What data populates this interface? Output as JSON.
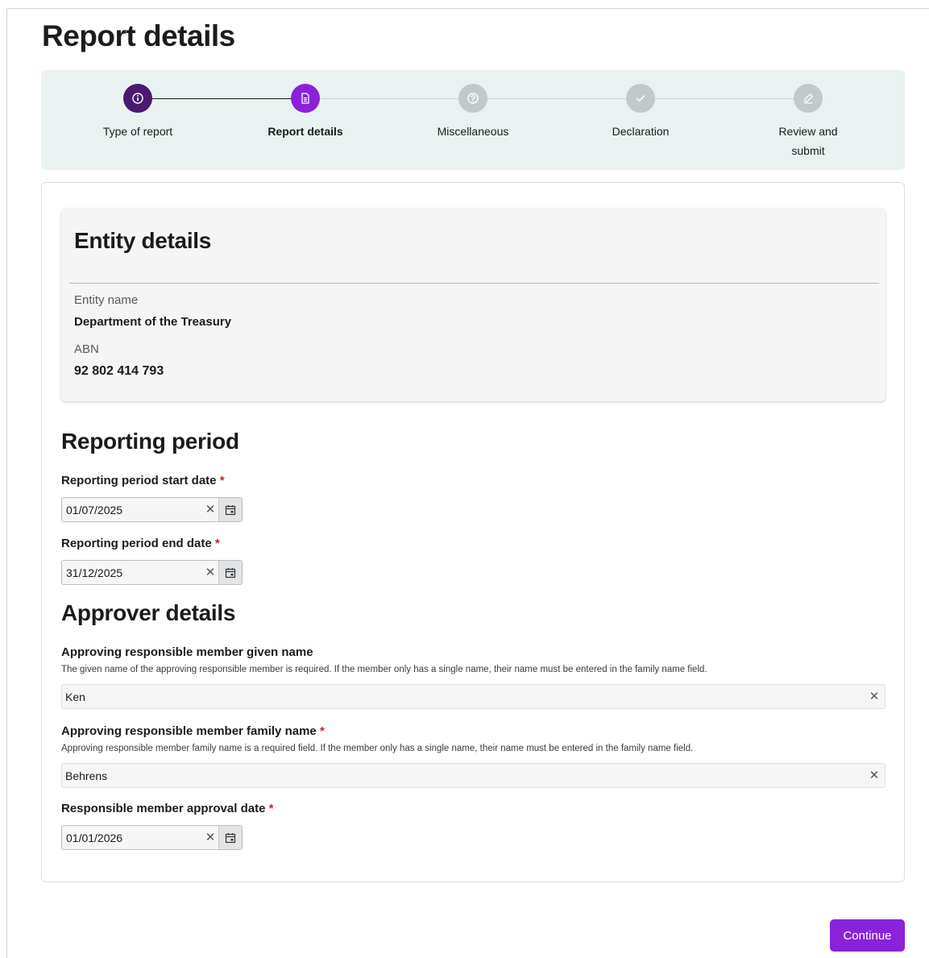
{
  "page": {
    "title": "Report details"
  },
  "stepper": {
    "steps": [
      {
        "label": "Type of report",
        "state": "completed",
        "icon": "info-icon"
      },
      {
        "label": "Report details",
        "state": "current",
        "icon": "document-icon"
      },
      {
        "label": "Miscellaneous",
        "state": "upcoming",
        "icon": "question-icon"
      },
      {
        "label": "Declaration",
        "state": "upcoming",
        "icon": "check-icon"
      },
      {
        "label_line1": "Review and",
        "label_line2": "submit",
        "state": "upcoming",
        "icon": "edit-icon"
      }
    ],
    "colors": {
      "completed": "#4a1a6e",
      "current": "#8a22d9",
      "upcoming": "#c2c9cd",
      "background": "#e9f2f1"
    }
  },
  "entity": {
    "title": "Entity details",
    "name_label": "Entity name",
    "name_value": "Department of the Treasury",
    "abn_label": "ABN",
    "abn_value": "92 802 414 793"
  },
  "reporting_period": {
    "title": "Reporting period",
    "start_label": "Reporting period start date",
    "start_value": "01/07/2025",
    "end_label": "Reporting period end date",
    "end_value": "31/12/2025",
    "required_marker": "*"
  },
  "approver": {
    "title": "Approver details",
    "given_label": "Approving responsible member given name",
    "given_help": "The given name of the approving responsible member is required. If the member only has a single name, their name must be entered in the family name field.",
    "given_value": "Ken",
    "family_label": "Approving responsible member family name",
    "family_help": "Approving responsible member family name is a required field. If the member only has a single name, their name must be entered in the family name field.",
    "family_value": "Behrens",
    "approval_label": "Responsible member approval date",
    "approval_value": "01/01/2026",
    "required_marker": "*"
  },
  "actions": {
    "continue_label": "Continue",
    "accent": "#8a22d9"
  }
}
